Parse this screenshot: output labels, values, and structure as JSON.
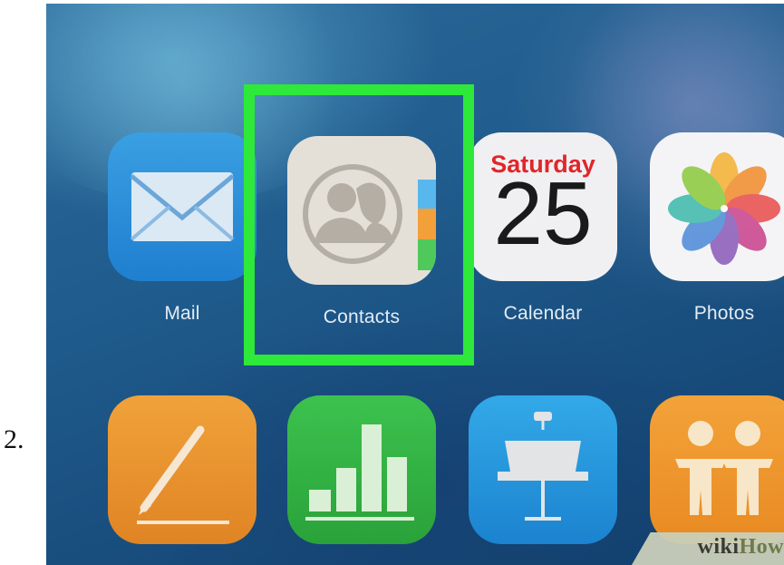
{
  "step": {
    "number": "2."
  },
  "apps_row1": [
    {
      "label": "Mail",
      "icon": "mail-icon"
    },
    {
      "label": "Contacts",
      "icon": "contacts-icon"
    },
    {
      "label": "Calendar",
      "icon": "calendar-icon",
      "day": "Saturday",
      "date": "25"
    },
    {
      "label": "Photos",
      "icon": "photos-icon"
    }
  ],
  "apps_row2": [
    {
      "icon": "pages-icon"
    },
    {
      "icon": "numbers-icon"
    },
    {
      "icon": "keynote-icon"
    },
    {
      "icon": "find-friends-icon"
    }
  ],
  "highlight": {
    "color": "#2ee83a",
    "target": "Contacts"
  },
  "watermark": {
    "prefix": "wiki",
    "suffix": "How"
  },
  "colors": {
    "wallpaper": "#1f5b8c",
    "calendar_red": "#e0262a",
    "label_text": "#e3ecf4"
  }
}
